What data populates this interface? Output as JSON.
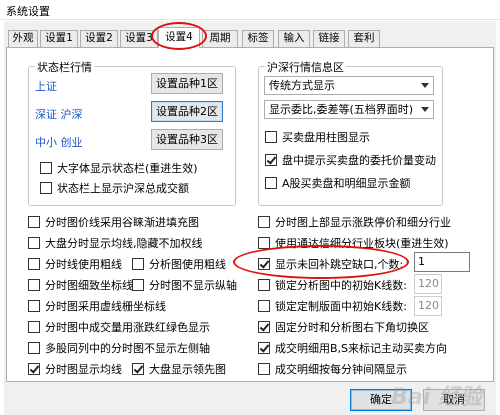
{
  "window": {
    "title": "系统设置"
  },
  "tabs": [
    {
      "label": "外观"
    },
    {
      "label": "设置1"
    },
    {
      "label": "设置2"
    },
    {
      "label": "设置3"
    },
    {
      "label": "设置4"
    },
    {
      "label": "周期"
    },
    {
      "label": "标签"
    },
    {
      "label": "输入"
    },
    {
      "label": "链接"
    },
    {
      "label": "套利"
    }
  ],
  "status_group": {
    "title": "状态栏行情",
    "rows": [
      {
        "market": "上证",
        "button": "设置品种1区"
      },
      {
        "market": "深证 沪深",
        "button": "设置品种2区"
      },
      {
        "market": "中小 创业",
        "button": "设置品种3区"
      }
    ],
    "checkboxes": [
      {
        "label": "大字体显示状态栏(重进生效)",
        "checked": false
      },
      {
        "label": "状态栏上显示沪深总成交额",
        "checked": false
      }
    ]
  },
  "deep_group": {
    "title": "沪深行情信息区",
    "select1": "传统方式显示",
    "select2": "显示委比,委差等(五档界面时)",
    "checkboxes": [
      {
        "label": "买卖盘用柱图显示",
        "checked": false
      },
      {
        "label": "盘中提示买卖盘的委托价量变动",
        "checked": true
      },
      {
        "label": "A股买卖盘和明细显示金额",
        "checked": false
      }
    ]
  },
  "left_options": [
    {
      "label": "分时图价线采用谷睐渐进填充图",
      "checked": false
    },
    {
      "label": "大盘分时显示均线,隐藏不加权线",
      "checked": false
    },
    {
      "label": "分时线使用粗线",
      "checked": false
    },
    {
      "label": "分时图细致坐标线",
      "checked": false
    },
    {
      "label": "分时图采用虚线栅坐标线",
      "checked": false
    },
    {
      "label": "分时图中成交量用涨跌红绿色显示",
      "checked": false
    },
    {
      "label": "多股同列中的分时图不显示左侧轴",
      "checked": false
    },
    {
      "label": "分时图显示均线",
      "checked": true
    }
  ],
  "mid_options": [
    {
      "label": "分析图使用粗线",
      "checked": false
    },
    {
      "label": "分时图不显示纵轴",
      "checked": false
    },
    {
      "label": "大盘显示领先图",
      "checked": true
    }
  ],
  "right_options": [
    {
      "label": "分时图上部显示涨跌停价和细分行业",
      "checked": false
    },
    {
      "label": "使用通达信细分行业板块(重进生效)",
      "checked": false
    },
    {
      "label": "显示未回补跳空缺口,个数:",
      "checked": true,
      "value": "1"
    },
    {
      "label": "锁定分析图中的初始K线数:",
      "checked": false,
      "value": "120"
    },
    {
      "label": "锁定定制版面中初始K线数:",
      "checked": false,
      "value": "120"
    },
    {
      "label": "固定分时和分析图右下角切换区",
      "checked": true
    },
    {
      "label": "成交明细用B,S来标记主动买卖方向",
      "checked": true
    },
    {
      "label": "成交明细按每分钟间隔显示",
      "checked": false
    }
  ],
  "footer": {
    "ok": "确定",
    "cancel": "取消"
  },
  "watermark": "Bai 经验",
  "colors": {
    "highlight_oval": "#e01010",
    "market_label": "#1a56c9"
  }
}
